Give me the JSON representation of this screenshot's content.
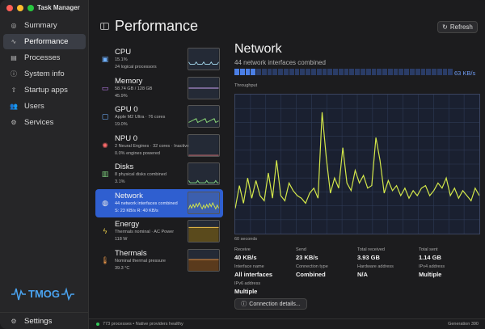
{
  "app": {
    "title": "Task Manager"
  },
  "colors": {
    "accent": "#2f5fd0",
    "graph_line": "#d4e84a",
    "close": "#ff5f57",
    "minimize": "#febc2e",
    "zoom": "#28c840"
  },
  "sidebar": {
    "items": [
      {
        "label": "Summary",
        "icon": "summary-icon",
        "glyph": "◎",
        "active": false
      },
      {
        "label": "Performance",
        "icon": "pulse-icon",
        "glyph": "∿",
        "active": true
      },
      {
        "label": "Processes",
        "icon": "list-icon",
        "glyph": "▤",
        "active": false
      },
      {
        "label": "System info",
        "icon": "info-icon",
        "glyph": "ⓘ",
        "active": false
      },
      {
        "label": "Startup apps",
        "icon": "startup-icon",
        "glyph": "⇧",
        "active": false
      },
      {
        "label": "Users",
        "icon": "users-icon",
        "glyph": "👥",
        "active": false
      },
      {
        "label": "Services",
        "icon": "gear-icon",
        "glyph": "⚙",
        "active": false
      }
    ],
    "logo_text": "TMOG",
    "settings_label": "Settings"
  },
  "header": {
    "title": "Performance",
    "refresh_label": "Refresh"
  },
  "resources": [
    {
      "name": "CPU",
      "sub": "15.1%",
      "sub2": "24 logical processors",
      "icon": "cpu-icon",
      "glyph": "▣",
      "color": "#6fb1ff",
      "thumb_color": "#9acbe0"
    },
    {
      "name": "Memory",
      "sub": "58.74 GB / 128 GB",
      "sub2": "45.9%",
      "icon": "memory-icon",
      "glyph": "▭",
      "color": "#c07ff5",
      "thumb_color": "#c8a0f0"
    },
    {
      "name": "GPU 0",
      "sub": "Apple M2 Ultra · 76 cores",
      "sub2": "19.0%",
      "icon": "gpu-icon",
      "glyph": "▢",
      "color": "#6fb1ff",
      "thumb_color": "#8fe07a"
    },
    {
      "name": "NPU 0",
      "sub": "2 Neural Engines · 32 cores · Inactive",
      "sub2": "0.0% engines powered",
      "icon": "npu-icon",
      "glyph": "✺",
      "color": "#ff6b6b",
      "thumb_color": "#e07a7a"
    },
    {
      "name": "Disks",
      "sub": "8 physical disks combined",
      "sub2": "3.1%",
      "icon": "disk-icon",
      "glyph": "▥",
      "color": "#7fd27f",
      "thumb_color": "#7fd27f"
    },
    {
      "name": "Network",
      "sub": "44 network interfaces combined",
      "sub2": "S: 23 KB/s  R: 40 KB/s",
      "icon": "network-icon",
      "glyph": "◍",
      "color": "#e8e8e8",
      "thumb_color": "#d4e84a",
      "active": true
    },
    {
      "name": "Energy",
      "sub": "Thermals nominal · AC Power",
      "sub2": "118 W",
      "icon": "energy-icon",
      "glyph": "ϟ",
      "color": "#f0d24a",
      "thumb_color": "#f0c24a"
    },
    {
      "name": "Thermals",
      "sub": "Nominal thermal pressure",
      "sub2": "39.3 °C",
      "icon": "thermals-icon",
      "glyph": "🌡",
      "color": "#f09a4a",
      "thumb_color": "#f09a4a"
    }
  ],
  "detail": {
    "title": "Network",
    "subtitle": "44 network interfaces combined",
    "throughput_value": "63 KB/s",
    "throughput_fill": 0.1,
    "throughput_label": "Throughput",
    "graph_footer": "60 seconds",
    "stats": [
      {
        "label": "Receive",
        "value": "40 KB/s"
      },
      {
        "label": "Send",
        "value": "23 KB/s"
      },
      {
        "label": "Total received",
        "value": "3.93 GB"
      },
      {
        "label": "Total sent",
        "value": "1.14 GB"
      },
      {
        "label": "Interface name",
        "value": "All interfaces"
      },
      {
        "label": "Connection type",
        "value": "Combined"
      },
      {
        "label": "Hardware address",
        "value": "N/A"
      },
      {
        "label": "IPv4 address",
        "value": "Multiple"
      },
      {
        "label": "IPv6 address",
        "value": "Multiple"
      }
    ],
    "connection_button": "Connection details..."
  },
  "status": {
    "text": "773 processes • Native providers healthy",
    "generation": "Generation 390"
  },
  "chart_data": {
    "type": "line",
    "title": "",
    "xlabel": "",
    "ylabel": "",
    "series": [
      {
        "values": [
          20,
          38,
          24,
          44,
          28,
          42,
          30,
          26,
          48,
          28,
          58,
          30,
          26,
          40,
          34,
          30,
          28,
          24,
          32,
          36,
          28,
          96,
          60,
          32,
          44,
          36,
          68,
          40,
          34,
          50,
          40,
          46,
          36,
          38,
          76,
          58,
          32,
          42,
          34,
          38,
          30,
          36,
          28,
          34,
          30,
          36,
          38,
          30,
          34,
          40,
          36,
          44,
          30,
          36,
          28,
          34,
          30,
          26,
          36,
          30
        ]
      }
    ],
    "ylim": [
      0,
      110
    ]
  }
}
